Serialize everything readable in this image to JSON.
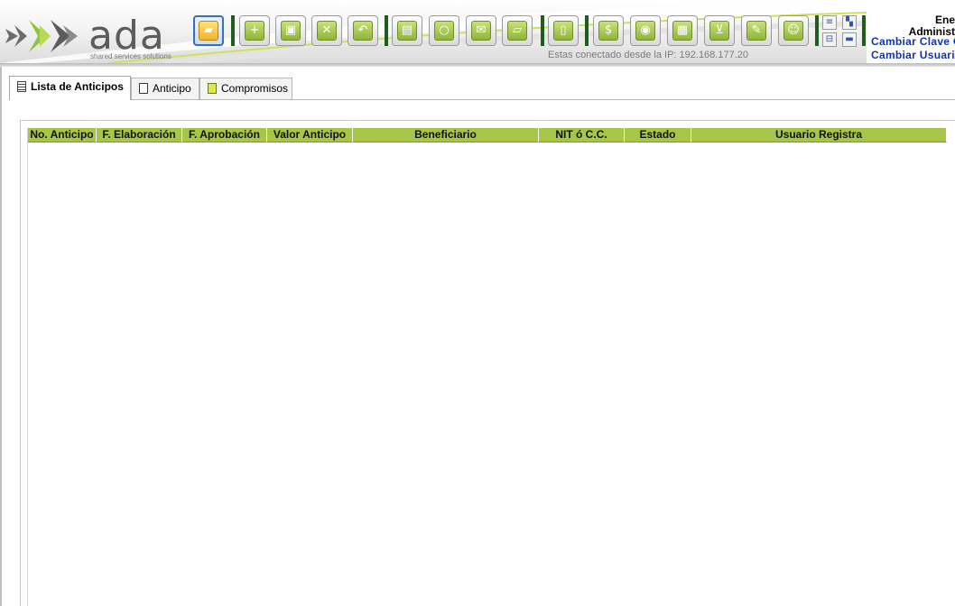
{
  "brand": {
    "name": "ada",
    "tagline": "shared services solutions"
  },
  "toolbar": {
    "buttons": [
      {
        "icon": "open-folder-icon",
        "glyph": "▰"
      },
      {
        "icon": "new-document-icon",
        "glyph": "+"
      },
      {
        "icon": "save-disk-icon",
        "glyph": "▣"
      },
      {
        "icon": "delete-document-icon",
        "glyph": "✕"
      },
      {
        "icon": "undo-icon",
        "glyph": "↶"
      },
      {
        "icon": "printer-icon",
        "glyph": "▤"
      },
      {
        "icon": "search-magnifier-icon",
        "glyph": "○"
      },
      {
        "icon": "export-excel-icon",
        "glyph": "✉"
      },
      {
        "icon": "import-package-icon",
        "glyph": "▱"
      },
      {
        "icon": "lock-icon",
        "glyph": "▯"
      },
      {
        "icon": "money-bag-icon",
        "glyph": "$"
      },
      {
        "icon": "camera-icon",
        "glyph": "◉"
      },
      {
        "icon": "modules-grid-icon",
        "glyph": "▦"
      },
      {
        "icon": "shopping-cart-icon",
        "glyph": "⊻"
      },
      {
        "icon": "approve-stamp-icon",
        "glyph": "✎"
      },
      {
        "icon": "users-icon",
        "glyph": "☺"
      }
    ],
    "mini_buttons": [
      {
        "icon": "list-view-icon",
        "glyph": "≡"
      },
      {
        "icon": "colors-icon",
        "glyph": "▚"
      },
      {
        "icon": "tree-view-icon",
        "glyph": "⊟"
      },
      {
        "icon": "picture-icon",
        "glyph": "▬"
      }
    ],
    "accent_color": "#1d5e1d",
    "selected_border_color": "#2f6fd0"
  },
  "session": {
    "ip_label": "Estas conectado desde la IP: 192.168.177.20",
    "month": "Ene",
    "role": "Administ",
    "change_password_link": "Cambiar Clave  C",
    "change_user_link": "Cambiar Usuario",
    "link_color": "#1033b8"
  },
  "tabs": [
    {
      "label": "Lista de Anticipos",
      "icon": "list-document-icon",
      "active": true
    },
    {
      "label": "Anticipo",
      "icon": "document-icon",
      "active": false
    },
    {
      "label": "Compromisos",
      "icon": "notes-icon",
      "active": false
    }
  ],
  "grid": {
    "header_color": "#a6c64a",
    "columns": [
      "No. Anticipo",
      "F. Elaboración",
      "F. Aprobación",
      "Valor Anticipo",
      "Beneficiario",
      "NIT ó C.C.",
      "Estado",
      "Usuario Registra"
    ],
    "rows": []
  }
}
